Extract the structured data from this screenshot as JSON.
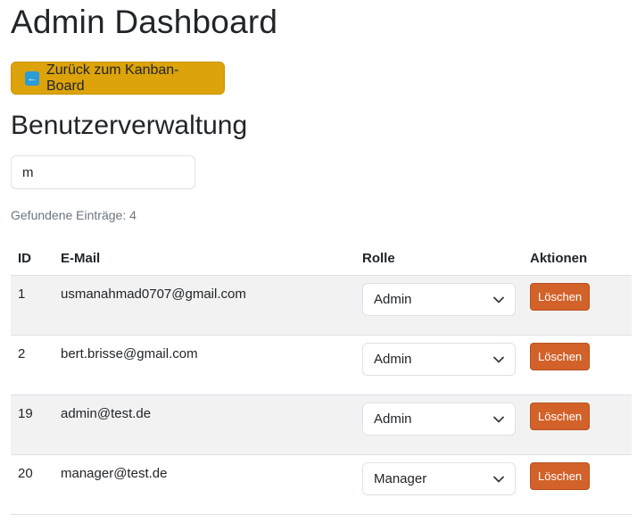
{
  "page": {
    "title": "Admin Dashboard"
  },
  "back_button": {
    "label": "Zurück zum Kanban-Board",
    "icon": "left-arrow-icon"
  },
  "section": {
    "title": "Benutzerverwaltung"
  },
  "search": {
    "value": "m"
  },
  "results": {
    "count_text": "Gefundene Einträge: 4"
  },
  "table": {
    "headers": {
      "id": "ID",
      "email": "E-Mail",
      "role": "Rolle",
      "actions": "Aktionen"
    },
    "rows": [
      {
        "id": "1",
        "email": "usmanahmad0707@gmail.com",
        "role": "Admin",
        "delete_label": "Löschen"
      },
      {
        "id": "2",
        "email": "bert.brisse@gmail.com",
        "role": "Admin",
        "delete_label": "Löschen"
      },
      {
        "id": "19",
        "email": "admin@test.de",
        "role": "Admin",
        "delete_label": "Löschen"
      },
      {
        "id": "20",
        "email": "manager@test.de",
        "role": "Manager",
        "delete_label": "Löschen"
      }
    ]
  },
  "colors": {
    "back_button": "#dca30a",
    "delete_button": "#d2622a",
    "stripe": "#f2f2f2"
  }
}
